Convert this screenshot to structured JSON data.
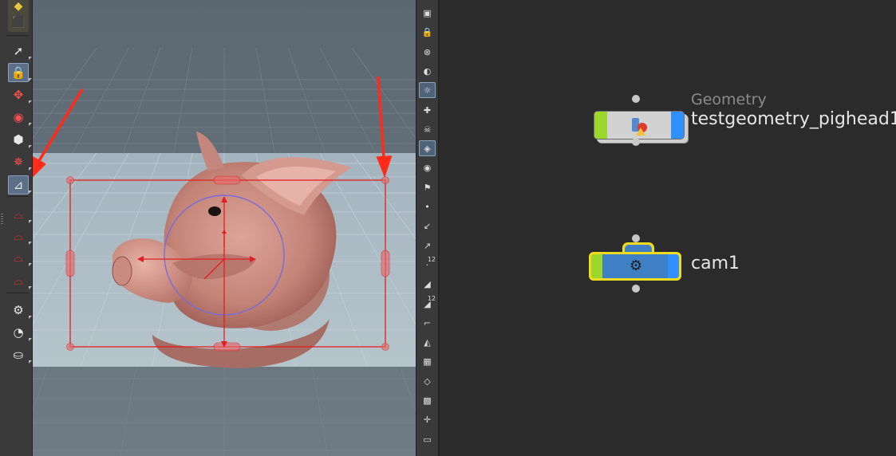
{
  "left_toolbar": {
    "tools": [
      {
        "name": "select-icon",
        "glyph": "➚"
      },
      {
        "name": "lock-icon",
        "glyph": "🔒",
        "active": true
      },
      {
        "name": "transform-icon",
        "glyph": "✥"
      },
      {
        "name": "rotate-icon",
        "glyph": "◉"
      },
      {
        "name": "scale-icon",
        "glyph": "⬢"
      },
      {
        "name": "pose-icon",
        "glyph": "✵"
      },
      {
        "name": "handle-icon",
        "glyph": "⊿",
        "active": true
      },
      {
        "name": "magnet-edit-icon",
        "glyph": "⌓"
      },
      {
        "name": "magnet-curve-icon",
        "glyph": "⌓"
      },
      {
        "name": "magnet-point-icon",
        "glyph": "⌓"
      },
      {
        "name": "magnet-icon",
        "glyph": "⌓"
      },
      {
        "name": "camera-tool-icon",
        "glyph": "⚙"
      },
      {
        "name": "view-tool-icon",
        "glyph": "◔"
      },
      {
        "name": "disk-icon",
        "glyph": "⛀"
      }
    ]
  },
  "right_shelf": {
    "tools": [
      {
        "name": "display-options-icon",
        "glyph": "▣"
      },
      {
        "name": "lock-camera-icon",
        "glyph": "🔒"
      },
      {
        "name": "cancel-icon",
        "glyph": "⊗"
      },
      {
        "name": "light-icon",
        "glyph": "◐"
      },
      {
        "name": "headlight-icon",
        "glyph": "☼",
        "active": true
      },
      {
        "name": "add-light-icon",
        "glyph": "✚"
      },
      {
        "name": "skull-icon",
        "glyph": "☠"
      },
      {
        "name": "ghost-icon",
        "glyph": "◈",
        "active": true
      },
      {
        "name": "eye-icon",
        "glyph": "◉"
      },
      {
        "name": "camera-icon",
        "glyph": "⚑"
      },
      {
        "name": "point-icon",
        "glyph": "•"
      },
      {
        "name": "normal-icon",
        "glyph": "↙"
      },
      {
        "name": "vector-icon",
        "glyph": "↗"
      },
      {
        "name": "point-number-icon",
        "glyph": "·",
        "num": "12"
      },
      {
        "name": "prim-icon",
        "glyph": "◢"
      },
      {
        "name": "prim-number-icon",
        "glyph": "◢",
        "num": "12"
      },
      {
        "name": "profile-icon",
        "glyph": "⌐"
      },
      {
        "name": "shaded-icon",
        "glyph": "◭"
      },
      {
        "name": "checker-icon",
        "glyph": "▦"
      },
      {
        "name": "wire-icon",
        "glyph": "◇"
      },
      {
        "name": "uv-icon",
        "glyph": "▩"
      },
      {
        "name": "axis-icon",
        "glyph": "✛"
      },
      {
        "name": "more-icon",
        "glyph": "▭"
      }
    ]
  },
  "network": {
    "nodes": [
      {
        "type_label": "Geometry",
        "name": "testgeometry_pighead1"
      },
      {
        "type_label": "",
        "name": "cam1"
      }
    ]
  },
  "colors": {
    "viewport_bg": "#5c6b77",
    "bbox_red": "#e02020",
    "gizmo_circle": "#7a6cd9",
    "geo_node_left": "#9bd82b",
    "geo_node_right": "#3090ff",
    "cam_node_fill": "#3f7fc4",
    "cam_node_selected": "#f0dc1e",
    "annotation_arrow": "#ff2a1a"
  }
}
